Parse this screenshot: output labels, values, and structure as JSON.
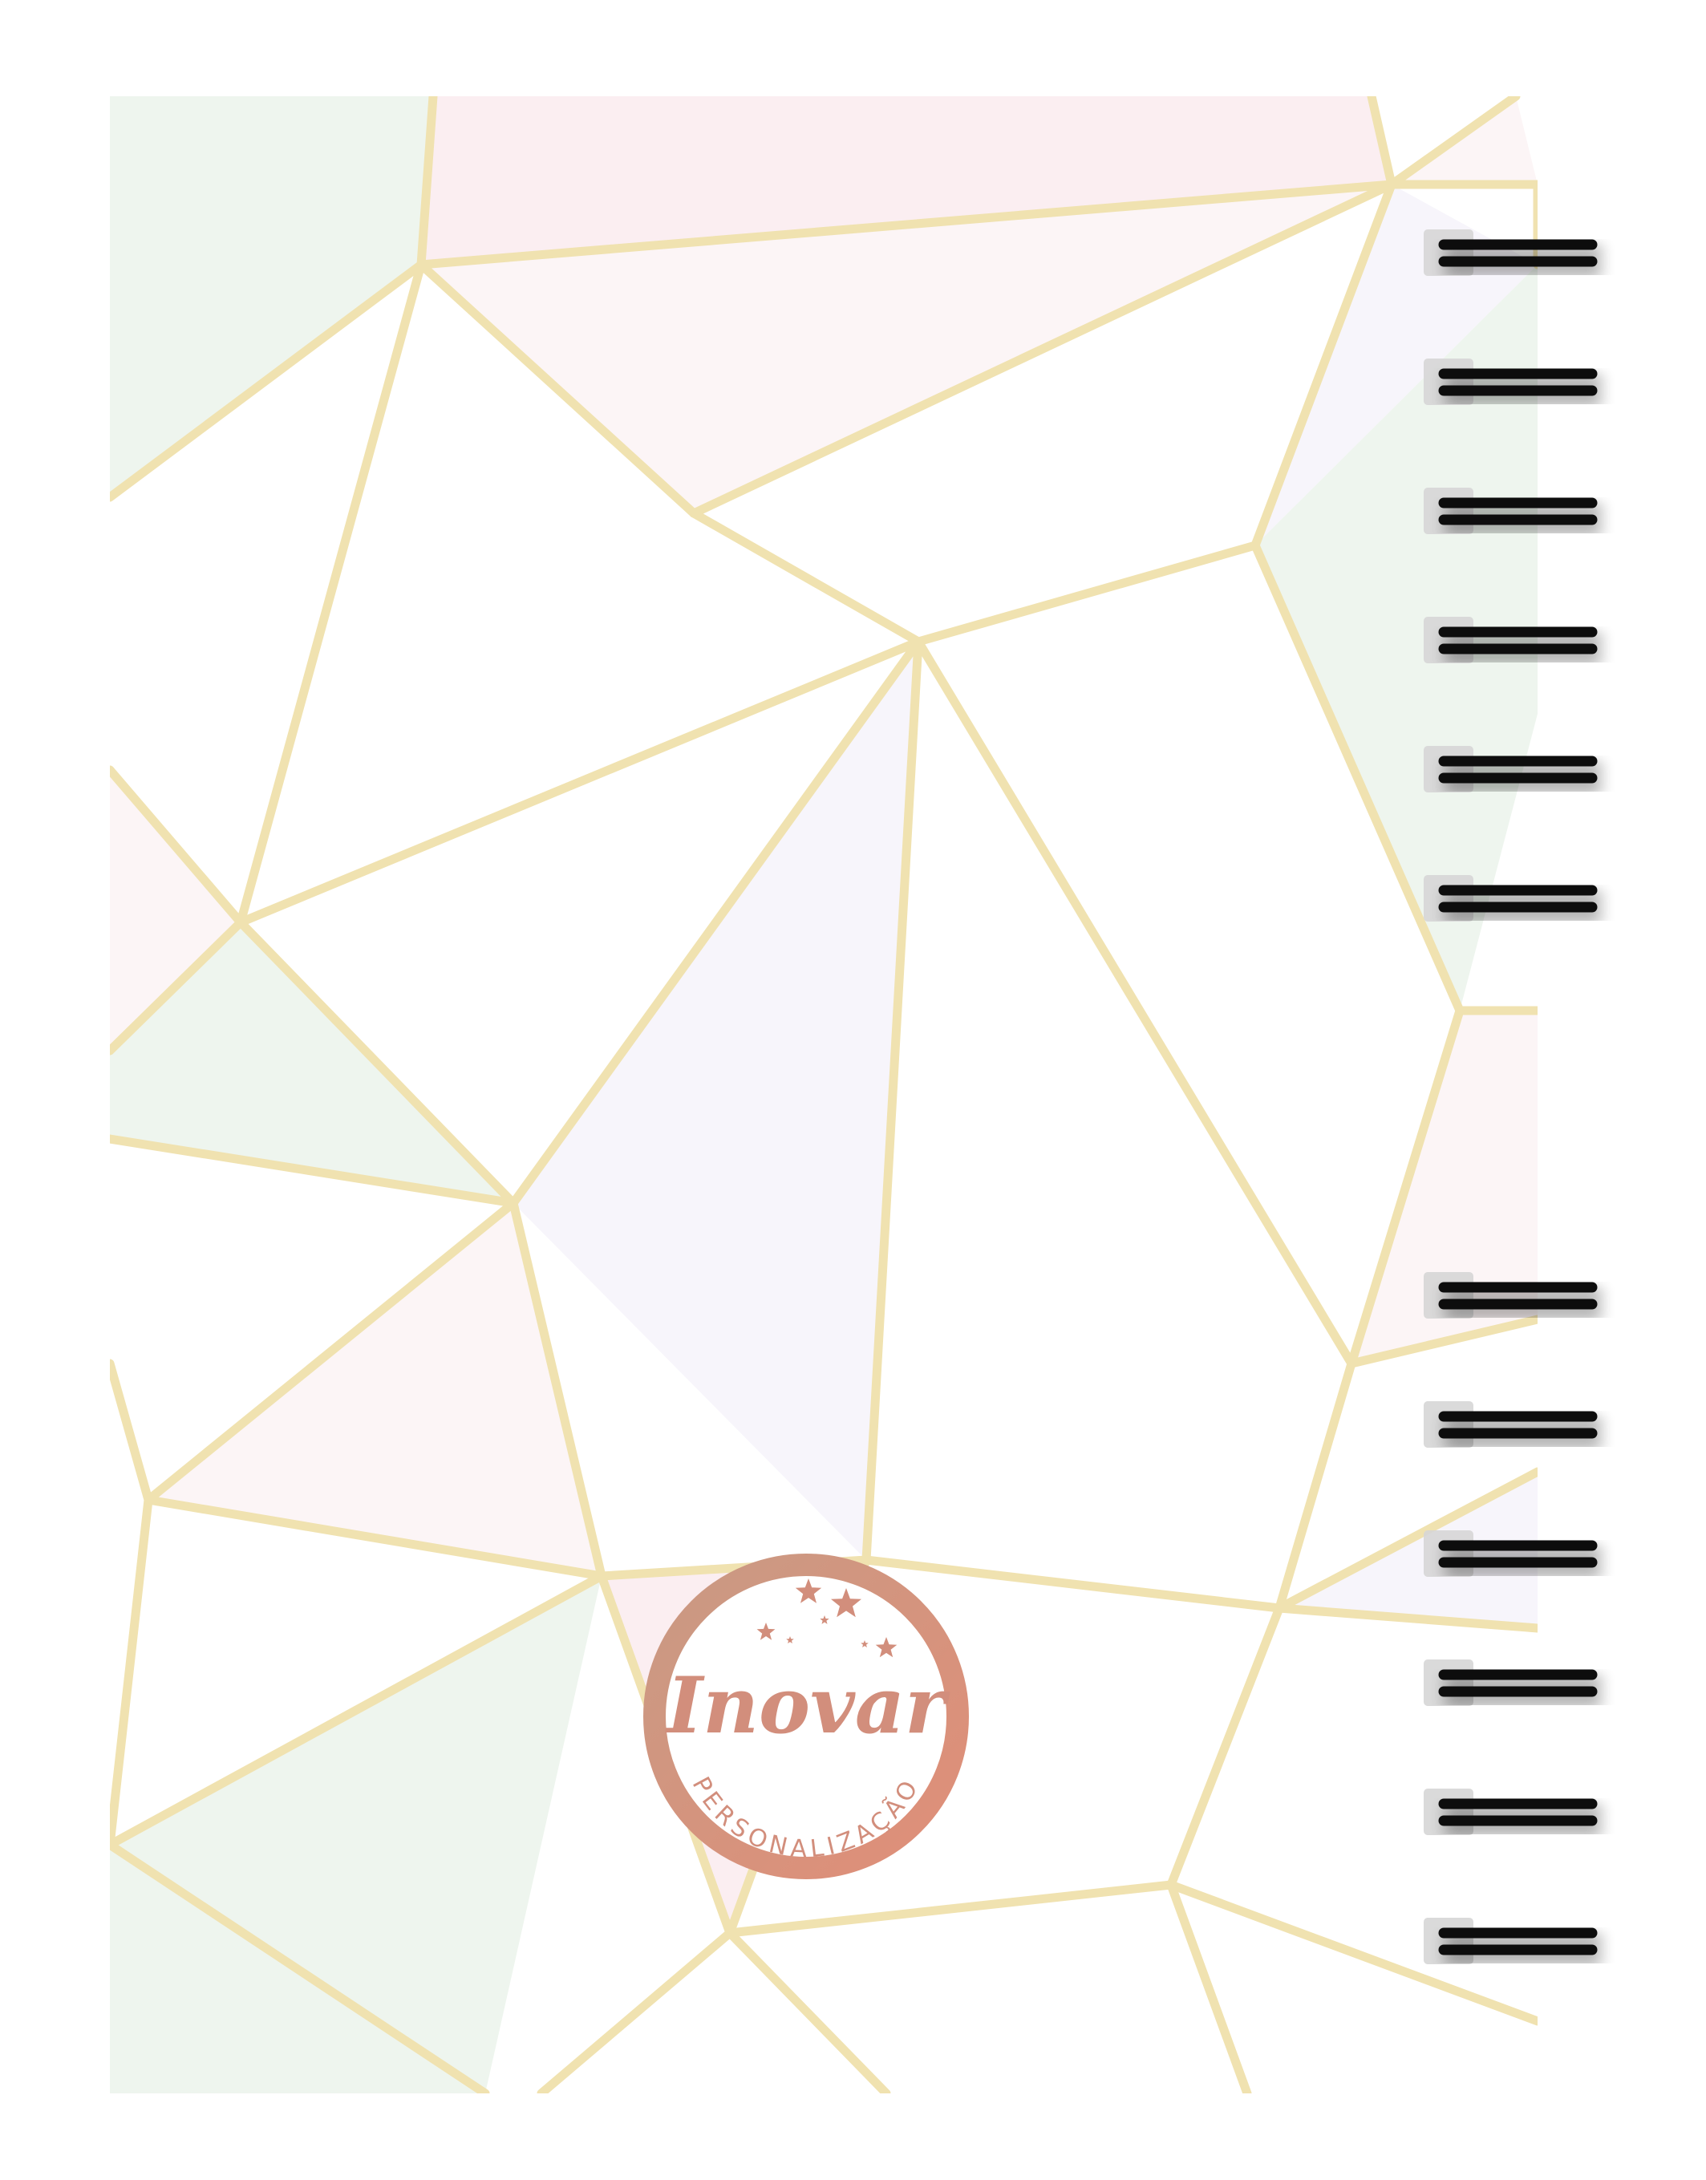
{
  "colors": {
    "background": "#ffffff",
    "line_gold": "#f0e2b0",
    "fill_pink": "#fbeef1",
    "fill_pink_light": "#fcf5f6",
    "fill_mint": "#eef5ee",
    "fill_lavender": "#f7f5fb",
    "logo_ring": "#d9957c",
    "logo_text": "#d28e7c",
    "spiral_wire": "#111111",
    "spiral_hole": "#d6d6d6"
  },
  "logo": {
    "brand": "Inovar",
    "subtitle": "PERSONALIZAÇÃO",
    "icon": "stars-icon"
  },
  "spiral": {
    "upper_ring_count": 6,
    "lower_ring_count": 6,
    "icon": "spiral-ring-icon"
  }
}
